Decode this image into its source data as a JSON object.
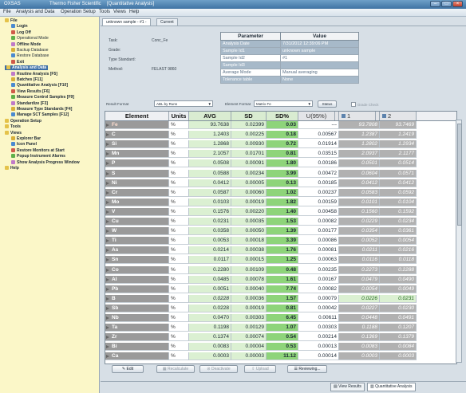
{
  "window": {
    "app": "OXSAS",
    "vendor": "Thermo Fisher Scientific",
    "module": "[Quantitative Analysis]"
  },
  "menu": [
    "File",
    "Analysis and Data",
    "Operation Setup",
    "Tools",
    "Views",
    "Help"
  ],
  "tree": [
    {
      "label": "File",
      "level": 0,
      "bold": true
    },
    {
      "label": "Login",
      "level": 1,
      "bold": true
    },
    {
      "label": "Log Off",
      "level": 1,
      "bold": true
    },
    {
      "label": "Operational Mode",
      "level": 1,
      "bold": false
    },
    {
      "label": "Offline Mode",
      "level": 1,
      "bold": true
    },
    {
      "label": "Backup Database",
      "level": 1,
      "bold": false
    },
    {
      "label": "Restore Database",
      "level": 1,
      "bold": false
    },
    {
      "label": "Exit",
      "level": 1,
      "bold": true
    },
    {
      "label": "Analysis and Data",
      "level": 0,
      "bold": true,
      "selected": true
    },
    {
      "label": "Routine Analysis [F5]",
      "level": 1,
      "bold": true
    },
    {
      "label": "Batches [F11]",
      "level": 1,
      "bold": true
    },
    {
      "label": "Quantitative Analysis [F10]",
      "level": 1,
      "bold": true
    },
    {
      "label": "View Results [F6]",
      "level": 1,
      "bold": true
    },
    {
      "label": "Measure Control Samples [F9]",
      "level": 1,
      "bold": true
    },
    {
      "label": "Standardize [F3]",
      "level": 1,
      "bold": true
    },
    {
      "label": "Measure Type Standards [F4]",
      "level": 1,
      "bold": true
    },
    {
      "label": "Manage SCT Samples [F12]",
      "level": 1,
      "bold": true
    },
    {
      "label": "Operation Setup",
      "level": 0,
      "bold": true
    },
    {
      "label": "Tools",
      "level": 0,
      "bold": true
    },
    {
      "label": "Views",
      "level": 0,
      "bold": true
    },
    {
      "label": "Explorer Bar",
      "level": 1,
      "bold": true
    },
    {
      "label": "Icon Panel",
      "level": 1,
      "bold": true
    },
    {
      "label": "Restore Monitors at Start",
      "level": 1,
      "bold": true
    },
    {
      "label": "Popup Instrument Alarms",
      "level": 1,
      "bold": true
    },
    {
      "label": "Show Analysis Progress Window",
      "level": 1,
      "bold": true
    },
    {
      "label": "Help",
      "level": 0,
      "bold": true
    }
  ],
  "tabs": [
    {
      "label": "unknown sample - #1 -",
      "active": true
    },
    {
      "label": "Current",
      "active": false
    }
  ],
  "info": [
    {
      "label": "Task:",
      "value": "Conc_Fe"
    },
    {
      "label": "Grade:",
      "value": ""
    },
    {
      "label": "Type Standard:",
      "value": ""
    },
    {
      "label": "Method:",
      "value": "FELAST 9860"
    }
  ],
  "params": {
    "headers": [
      "Parameter",
      "Value"
    ],
    "rows": [
      {
        "k": "Analysis Date",
        "v": "7/31/2012 12:39:06 PM",
        "editable": false
      },
      {
        "k": "Sample Id1",
        "v": "unknown sample",
        "editable": false
      },
      {
        "k": "Sample Id2",
        "v": "#1",
        "editable": true
      },
      {
        "k": "Sample Id3",
        "v": "",
        "editable": false
      },
      {
        "k": "Average Mode",
        "v": "Manual averaging",
        "editable": true
      },
      {
        "k": "Tolerance table",
        "v": "None",
        "editable": false
      }
    ]
  },
  "filters": {
    "result_format_label": "Result Format",
    "result_format_value": "ABL by Runs",
    "element_format_label": "Element Format",
    "element_format_value": "Matrix Fe",
    "status_button": "Status",
    "grade_check_label": "Grade Check"
  },
  "grid": {
    "headers": [
      "Element",
      "Units",
      "AVG",
      "SD",
      "SD%",
      "U(95%)",
      "1",
      "2"
    ],
    "rows": [
      [
        "Fe",
        "%",
        "93.7638",
        "0.02399",
        "0.03",
        "---",
        "93.7808",
        "93.7469"
      ],
      [
        "C",
        "%",
        "1.2403",
        "0.00225",
        "0.18",
        "0.00567",
        "1.2387",
        "1.2419"
      ],
      [
        "Si",
        "%",
        "1.2868",
        "0.00930",
        "0.72",
        "0.01914",
        "1.2802",
        "1.2934"
      ],
      [
        "Mn",
        "%",
        "2.1057",
        "0.01701",
        "0.81",
        "0.03515",
        "2.0937",
        "2.1177"
      ],
      [
        "P",
        "%",
        "0.0508",
        "0.00091",
        "1.80",
        "0.00186",
        "0.0501",
        "0.0514"
      ],
      [
        "S",
        "%",
        "0.0588",
        "0.00234",
        "3.99",
        "0.00472",
        "0.0604",
        "0.0571"
      ],
      [
        "Ni",
        "%",
        "0.0412",
        "0.00005",
        "0.13",
        "0.00185",
        "0.0412",
        "0.0412"
      ],
      [
        "Cr",
        "%",
        "0.0587",
        "0.00060",
        "1.02",
        "0.00237",
        "0.0583",
        "0.0592"
      ],
      [
        "Mo",
        "%",
        "0.0103",
        "0.00019",
        "1.82",
        "0.00159",
        "0.0101",
        "0.0104"
      ],
      [
        "V",
        "%",
        "0.1576",
        "0.00220",
        "1.40",
        "0.00458",
        "0.1560",
        "0.1592"
      ],
      [
        "Cu",
        "%",
        "0.0231",
        "0.00035",
        "1.53",
        "0.00082",
        "0.0229",
        "0.0234"
      ],
      [
        "W",
        "%",
        "0.0358",
        "0.00050",
        "1.39",
        "0.00177",
        "0.0354",
        "0.0361"
      ],
      [
        "Ti",
        "%",
        "0.0053",
        "0.00018",
        "3.39",
        "0.00086",
        "0.0052",
        "0.0054"
      ],
      [
        "As",
        "%",
        "0.0214",
        "0.00038",
        "1.76",
        "0.00081",
        "0.0211",
        "0.0216"
      ],
      [
        "Sn",
        "%",
        "0.0117",
        "0.00015",
        "1.25",
        "0.00063",
        "0.0116",
        "0.0118"
      ],
      [
        "Co",
        "%",
        "0.2280",
        "0.00109",
        "0.48",
        "0.00235",
        "0.2273",
        "0.2288"
      ],
      [
        "Al",
        "%",
        "0.0485",
        "0.00078",
        "1.61",
        "0.00167",
        "0.0479",
        "0.0490"
      ],
      [
        "Pb",
        "%",
        "0.0051",
        "0.00040",
        "7.74",
        "0.00082",
        "0.0054",
        "0.0049"
      ],
      [
        "B",
        "%",
        "0.0228",
        "0.00036",
        "1.57",
        "0.00079",
        "0.0226",
        "0.0231"
      ],
      [
        "Sb",
        "%",
        "0.0228",
        "0.00019",
        "0.81",
        "0.00042",
        "0.0227",
        "0.0230"
      ],
      [
        "Nb",
        "%",
        "0.0470",
        "0.00303",
        "6.45",
        "0.00611",
        "0.0448",
        "0.0491"
      ],
      [
        "Ta",
        "%",
        "0.1198",
        "0.00129",
        "1.07",
        "0.00303",
        "0.1188",
        "0.1207"
      ],
      [
        "Zr",
        "%",
        "0.1374",
        "0.00074",
        "0.54",
        "0.00214",
        "0.1369",
        "0.1379"
      ],
      [
        "Bi",
        "%",
        "0.0083",
        "0.00004",
        "0.53",
        "0.00013",
        "0.0083",
        "0.0084"
      ],
      [
        "Ca",
        "%",
        "0.0003",
        "0.00003",
        "11.12",
        "0.00014",
        "0.0003",
        "0.0003"
      ]
    ]
  },
  "bottom_buttons": [
    "Edit",
    "Recalculate",
    "Deactivate",
    "Upload",
    "Reviewing..."
  ],
  "status_tabs": [
    "View Results",
    "Quantitative Analysis"
  ]
}
